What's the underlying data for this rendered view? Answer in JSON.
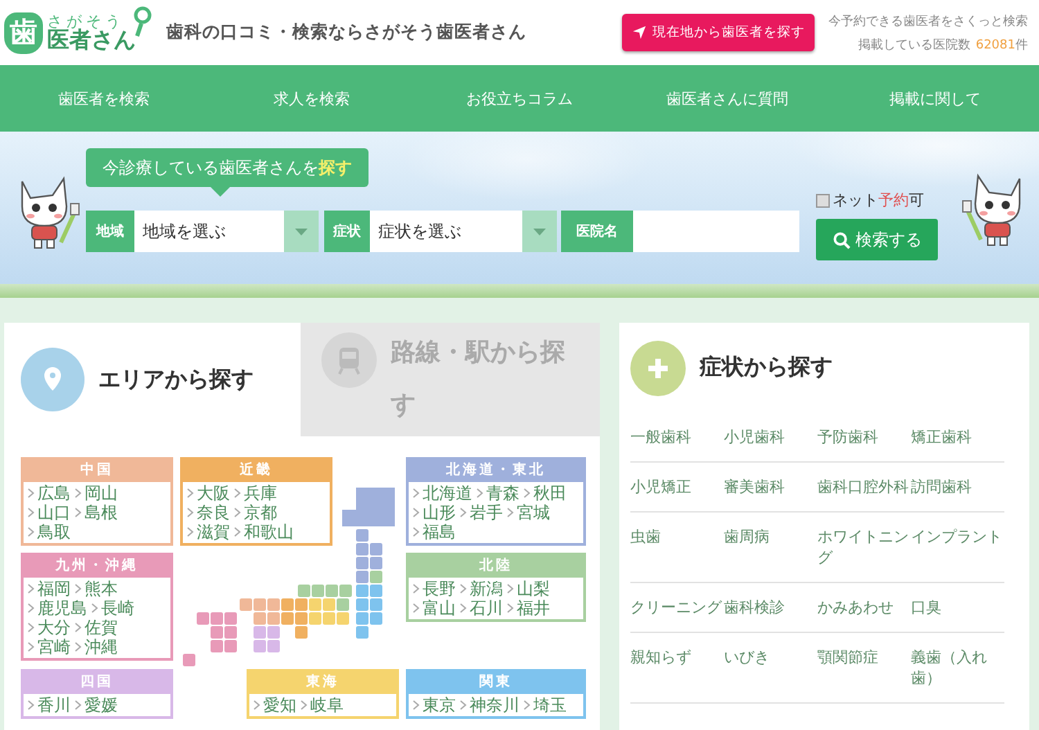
{
  "header": {
    "logo_mark": "歯",
    "logo_top": "さがそう",
    "logo_bottom": "医者さん",
    "tagline": "歯科の口コミ・検索ならさがそう歯医者さん",
    "locate_button": "現在地から歯医者を探す",
    "promo": "今予約できる歯医者をさくっと検索",
    "count_label": "掲載している医院数",
    "count": "62081",
    "count_unit": "件"
  },
  "nav": [
    {
      "label": "歯医者を検索"
    },
    {
      "label": "求人を検索"
    },
    {
      "label": "お役立ちコラム"
    },
    {
      "label": "歯医者さんに質問"
    },
    {
      "label": "掲載に関して"
    }
  ],
  "search": {
    "callout": "今診療している歯医者さんを**探す**",
    "area_label": "地域",
    "area_value": "地域を選ぶ",
    "symptom_label": "症状",
    "symptom_value": "症状を選ぶ",
    "clinic_label": "医院名",
    "net_reserve": {
      "label": "ネット**予約**可",
      "checked": false
    },
    "submit": "検索する"
  },
  "area_panel": {
    "tabs": [
      {
        "label": "エリアから探す",
        "selected": true
      },
      {
        "label": "路線・駅から探す",
        "selected": false
      }
    ],
    "regions": [
      {
        "name": "中国",
        "color": "#f0b898",
        "prefectures": [
          "広島",
          "岡山",
          "山口",
          "島根",
          "鳥取"
        ]
      },
      {
        "name": "近畿",
        "color": "#f0b060",
        "prefectures": [
          "大阪",
          "兵庫",
          "奈良",
          "京都",
          "滋賀",
          "和歌山"
        ]
      },
      {
        "name": "北海道・東北",
        "color": "#9fb0dc",
        "prefectures": [
          "北海道",
          "青森",
          "秋田",
          "山形",
          "岩手",
          "宮城",
          "福島"
        ]
      },
      {
        "name": "九州・沖縄",
        "color": "#e89ab8",
        "prefectures": [
          "福岡",
          "熊本",
          "鹿児島",
          "長崎",
          "大分",
          "佐賀",
          "宮崎",
          "沖縄"
        ]
      },
      {
        "name": "北陸",
        "color": "#a8d0a0",
        "prefectures": [
          "長野",
          "新潟",
          "山梨",
          "富山",
          "石川",
          "福井"
        ]
      },
      {
        "name": "四国",
        "color": "#d8b8e8",
        "prefectures": [
          "香川",
          "愛媛"
        ]
      },
      {
        "name": "東海",
        "color": "#f5d46e",
        "prefectures": [
          "愛知",
          "岐阜"
        ]
      },
      {
        "name": "関東",
        "color": "#7ec3ee",
        "prefectures": [
          "東京",
          "神奈川",
          "埼玉"
        ]
      }
    ]
  },
  "symptom_panel": {
    "title": "症状から探す",
    "rows": [
      [
        "一般歯科",
        "小児歯科",
        "予防歯科",
        "矯正歯科"
      ],
      [
        "小児矯正",
        "審美歯科",
        "歯科口腔外科",
        "訪問歯科"
      ],
      [
        "虫歯",
        "歯周病",
        "ホワイトニング",
        "インプラント"
      ],
      [
        "クリーニング",
        "歯科検診",
        "かみあわせ",
        "口臭"
      ],
      [
        "親知らず",
        "いびき",
        "顎関節症",
        "義歯（入れ歯）"
      ]
    ]
  }
}
